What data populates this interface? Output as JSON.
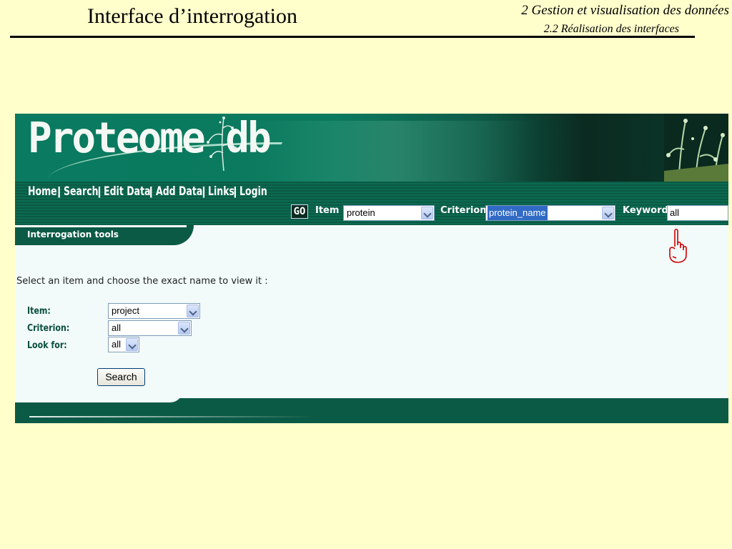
{
  "slide": {
    "title": "Interface d’interrogation",
    "section": "2 Gestion et visualisation des données",
    "subsection": "2.2 Réalisation des interfaces"
  },
  "app": {
    "logo": "Proteome db",
    "nav": [
      "Home",
      "Search",
      "Edit Data",
      "Add Data",
      "Links",
      "Login"
    ],
    "quick_search": {
      "go_label": "GO",
      "item_label": "Item :",
      "item_value": "protein",
      "criterion_label": "Criterion :",
      "criterion_value": "protein_name",
      "keyword_label": "Keyword :",
      "keyword_value": "all"
    },
    "tools_label": "Interrogation tools",
    "intro": "Select an item and choose the exact name to view it :",
    "form": {
      "item_label": "Item:",
      "item_value": "project",
      "criterion_label": "Criterion:",
      "criterion_value": "all",
      "lookfor_label": "Look for:",
      "lookfor_value": "all",
      "search_button": "Search"
    }
  },
  "colors": {
    "slide_bg": "#ffffcc",
    "banner_green": "#0b7a5e",
    "nav_green": "#0b5a45",
    "label_green": "#0b4f3e",
    "highlight": "#316ac5",
    "hand_red": "#cc0000"
  },
  "icons": [
    "plant-icon",
    "pointing-hand-icon",
    "chevron-down-icon"
  ]
}
